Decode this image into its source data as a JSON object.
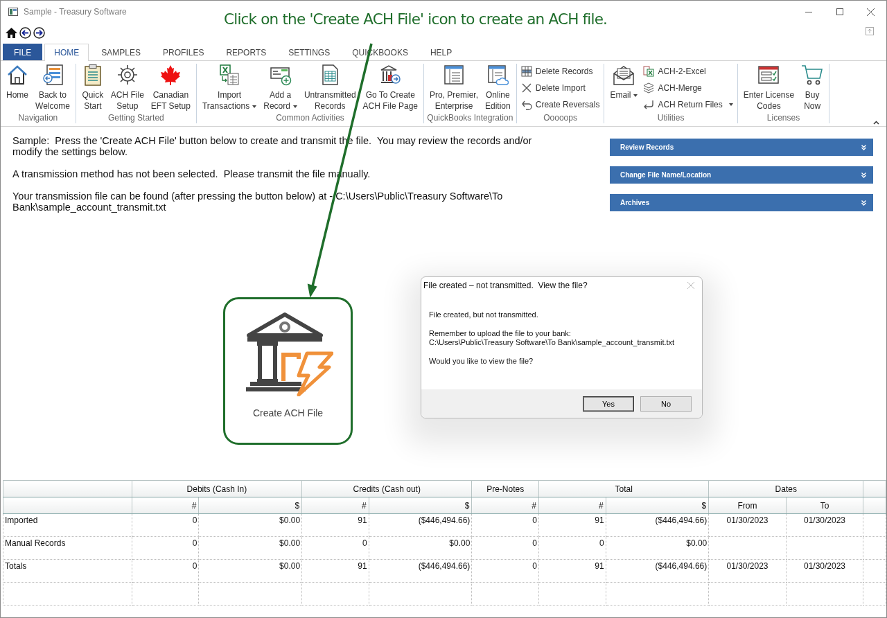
{
  "window": {
    "title": "Sample - Treasury Software"
  },
  "annotation": {
    "text": "Click on the 'Create ACH File' icon to create an ACH file."
  },
  "ribbon_tabs": [
    {
      "label": "FILE",
      "kind": "file",
      "selected": false
    },
    {
      "label": "HOME",
      "kind": "tab",
      "selected": true
    },
    {
      "label": "SAMPLES",
      "kind": "tab",
      "selected": false
    },
    {
      "label": "PROFILES",
      "kind": "tab",
      "selected": false
    },
    {
      "label": "REPORTS",
      "kind": "tab",
      "selected": false
    },
    {
      "label": "SETTINGS",
      "kind": "tab",
      "selected": false
    },
    {
      "label": "QUICKBOOKS",
      "kind": "tab",
      "selected": false
    },
    {
      "label": "HELP",
      "kind": "tab",
      "selected": false
    }
  ],
  "ribbon_groups": [
    {
      "label": "Navigation",
      "items": [
        {
          "kind": "large",
          "label": "Home",
          "has_menu": false
        },
        {
          "kind": "large",
          "label": "Back to\nWelcome",
          "has_menu": false
        }
      ]
    },
    {
      "label": "Getting Started",
      "items": [
        {
          "kind": "large",
          "label": "Quick\nStart",
          "has_menu": false
        },
        {
          "kind": "large",
          "label": "ACH File\nSetup",
          "has_menu": false
        },
        {
          "kind": "large",
          "label": "Canadian\nEFT Setup",
          "has_menu": false
        }
      ]
    },
    {
      "label": "Common Activities",
      "items": [
        {
          "kind": "large",
          "label": "Import\nTransactions",
          "has_menu": true
        },
        {
          "kind": "large",
          "label": "Add a\nRecord",
          "has_menu": true
        },
        {
          "kind": "large",
          "label": "Untransmitted\nRecords",
          "has_menu": false
        },
        {
          "kind": "large",
          "label": "Go To Create\nACH File Page",
          "has_menu": false
        }
      ]
    },
    {
      "label": "QuickBooks Integration",
      "items": [
        {
          "kind": "large",
          "label": "Pro, Premier,\nEnterprise",
          "has_menu": false
        },
        {
          "kind": "large",
          "label": "Online\nEdition",
          "has_menu": false
        }
      ]
    },
    {
      "label": "Ooooops",
      "items": [
        {
          "kind": "small",
          "label": "Delete Records",
          "has_menu": false
        },
        {
          "kind": "small",
          "label": "Delete Import",
          "has_menu": false
        },
        {
          "kind": "small",
          "label": "Create Reversals",
          "has_menu": false
        }
      ]
    },
    {
      "label": "Utilities",
      "items": [
        {
          "kind": "large",
          "label": "Email",
          "has_menu": true
        },
        {
          "kind": "small",
          "label": "ACH-2-Excel",
          "has_menu": false
        },
        {
          "kind": "small",
          "label": "ACH-Merge",
          "has_menu": false
        },
        {
          "kind": "small",
          "label": "ACH Return Files",
          "has_menu": true
        }
      ]
    },
    {
      "label": "Licenses",
      "items": [
        {
          "kind": "large",
          "label": "Enter License\nCodes",
          "has_menu": false
        },
        {
          "kind": "large",
          "label": "Buy\nNow",
          "has_menu": false
        }
      ]
    }
  ],
  "messages": [
    "Sample:  Press the 'Create ACH File' button below to create and transmit the file.  You may review the records and/or modify the settings below.",
    "A transmission method has not been selected.  Please transmit the file manually.",
    "Your transmission file can be found (after pressing the button below) at - C:\\Users\\Public\\Treasury Software\\To Bank\\sample_account_transmit.txt"
  ],
  "panels": [
    {
      "label": "Review Records"
    },
    {
      "label": "Change File Name/Location"
    },
    {
      "label": "Archives"
    }
  ],
  "create_button": {
    "label": "Create ACH File"
  },
  "dialog": {
    "title": "File created – not transmitted.  View the file?",
    "lines": [
      "File created, but not transmitted.",
      "Remember to upload the file to your bank:\nC:\\Users\\Public\\Treasury Software\\To Bank\\sample_account_transmit.txt",
      "Would you like to view the file?"
    ],
    "buttons": [
      {
        "label": "Yes",
        "default": true
      },
      {
        "label": "No",
        "default": false
      }
    ]
  },
  "summary_table": {
    "column_groups": [
      {
        "label": "Debits (Cash In)",
        "kind": "amount",
        "columns": [
          "#",
          "$"
        ]
      },
      {
        "label": "Credits (Cash out)",
        "kind": "amount",
        "columns": [
          "#",
          "$"
        ]
      },
      {
        "label": "Pre-Notes",
        "kind": "amount",
        "columns": [
          "#"
        ]
      },
      {
        "label": "Total",
        "kind": "amount",
        "columns": [
          "#",
          "$"
        ]
      },
      {
        "label": "Dates",
        "kind": "date",
        "columns": [
          "From",
          "To"
        ]
      }
    ],
    "rows": [
      {
        "label": "Imported",
        "cells": [
          "0",
          "$0.00",
          "91",
          "($446,494.66)",
          "0",
          "91",
          "($446,494.66)",
          "01/30/2023",
          "01/30/2023"
        ]
      },
      {
        "label": "Manual Records",
        "cells": [
          "0",
          "$0.00",
          "0",
          "$0.00",
          "0",
          "0",
          "$0.00",
          null,
          null
        ]
      },
      {
        "label": "Totals",
        "cells": [
          "0",
          "$0.00",
          "91",
          "($446,494.66)",
          "0",
          "91",
          "($446,494.66)",
          "01/30/2023",
          "01/30/2023"
        ]
      }
    ]
  }
}
